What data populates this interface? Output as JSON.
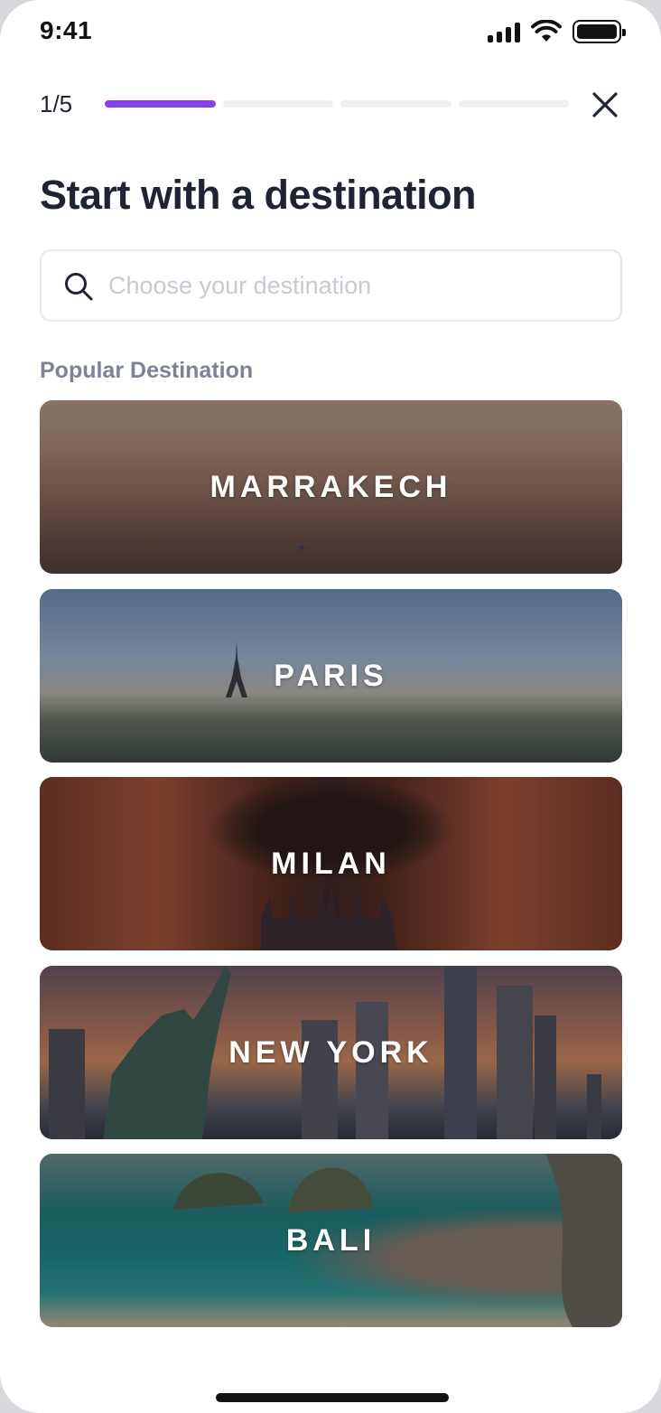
{
  "status_bar": {
    "time": "9:41",
    "icons": [
      "cellular-signal-icon",
      "wifi-icon",
      "battery-icon"
    ]
  },
  "header": {
    "step_counter": "1/5",
    "progress_steps_total": 5,
    "progress_current": 1,
    "accent_color": "#8b3ff2",
    "close_icon": "close-icon"
  },
  "title": "Start with a destination",
  "search": {
    "placeholder": "Choose your destination",
    "value": "",
    "icon": "search-icon"
  },
  "popular": {
    "label": "Popular Destination",
    "destinations": [
      {
        "name": "MARRAKECH"
      },
      {
        "name": "PARIS"
      },
      {
        "name": "MILAN"
      },
      {
        "name": "NEW YORK"
      },
      {
        "name": "BALI"
      }
    ]
  }
}
